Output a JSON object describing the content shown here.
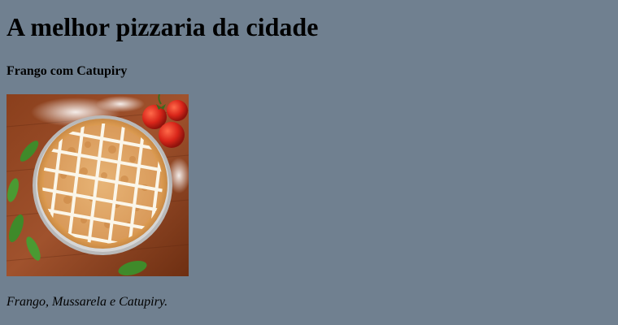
{
  "page": {
    "title": "A melhor pizzaria da cidade"
  },
  "pizza": {
    "name": "Frango com Catupiry",
    "description": "Frango, Mussarela e Catupiry.",
    "image_subject": "pizza-frango-catupiry"
  },
  "colors": {
    "background": "#708090"
  }
}
